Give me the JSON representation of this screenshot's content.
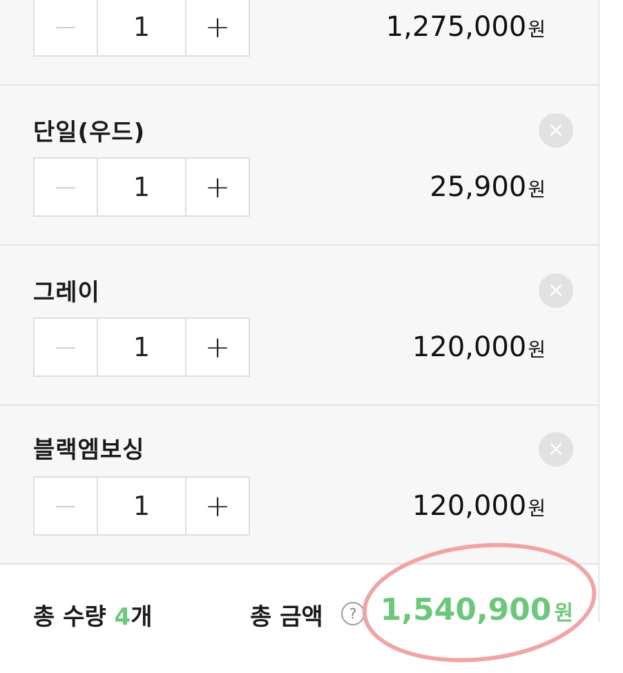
{
  "items": [
    {
      "name": "",
      "qty": "1",
      "price": "1,275,000",
      "currency": "원"
    },
    {
      "name": "단일(우드)",
      "qty": "1",
      "price": "25,900",
      "currency": "원"
    },
    {
      "name": "그레이",
      "qty": "1",
      "price": "120,000",
      "currency": "원"
    },
    {
      "name": "블랙엠보싱",
      "qty": "1",
      "price": "120,000",
      "currency": "원"
    }
  ],
  "stepper": {
    "minus": "−",
    "plus": "+"
  },
  "remove_icon": "×",
  "summary": {
    "qty_label": "총 수량",
    "qty_value": "4",
    "qty_unit": "개",
    "amount_label": "총 금액",
    "help": "?",
    "total": "1,540,900",
    "currency": "원"
  },
  "colors": {
    "accent": "#6cc77a",
    "annotation": "#f2a3a3",
    "card_bg": "#f7f7f7"
  }
}
